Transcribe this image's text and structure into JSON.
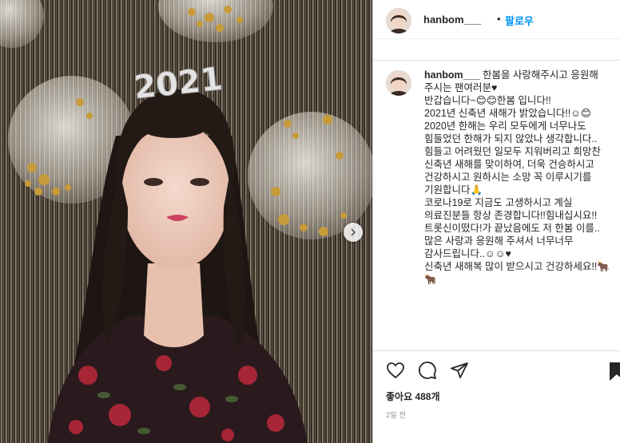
{
  "photo": {
    "headband_text": "2021",
    "next_icon": "chevron-right-icon"
  },
  "header": {
    "username": "hanbom___",
    "dot": "•",
    "follow_label": "팔로우"
  },
  "caption": {
    "username": "hanbom___",
    "text": " 한봄을 사랑해주시고 응원해 주시는 팬여러분♥\n반갑습니다~😊😊한봄 입니다!!\n2021년 신축년 새해가 밝았습니다!!☺😊\n2020년 한해는 우리 모두에게 너무나도 힘들었던 한해가 되지 않았나 생각합니다..\n힘들고 어려웠던 일모두 지워버리고 희망찬 신축년 새해를 맞이하여, 더욱 건승하시고 건강하시고 원하시는 소망 꼭 이루시기를 기원합니다🙏\n코로나19로 지금도 고생하시고 계실 의료진분들 항상 존경합니다!!힘내십시요!!\n트롯신이떴다!가 끝났음에도 저 한봄 이를..많은 사랑과 응원해 주셔서 너무너무 감사드립니다..☺☺♥\n신축년 새해복 많이 받으시고 건강하세요!!🐂🐂"
  },
  "actions": {
    "like_icon": "heart-icon",
    "comment_icon": "comment-icon",
    "share_icon": "share-icon",
    "save_icon": "bookmark-icon"
  },
  "likes_text": "좋아요 488개",
  "time_ago": "2일 전"
}
